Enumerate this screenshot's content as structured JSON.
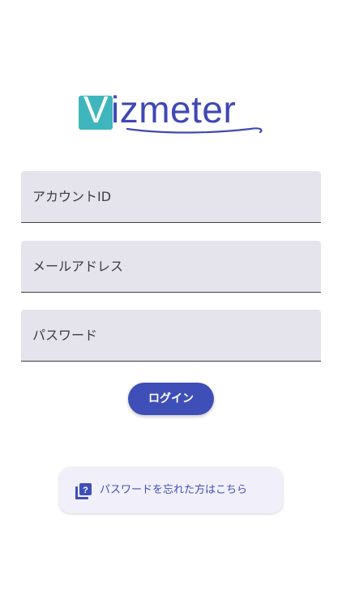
{
  "logo": {
    "initial": "V",
    "rest": "izmeter"
  },
  "form": {
    "account_id_placeholder": "アカウントID",
    "email_placeholder": "メールアドレス",
    "password_placeholder": "パスワード"
  },
  "login_button": {
    "label": "ログイン"
  },
  "forgot_password": {
    "label": "パスワードを忘れた方はこちら",
    "icon": "help-library-icon"
  },
  "colors": {
    "brand": "#3f48b5",
    "logo_teal": "#3fb6bd",
    "field_background": "#e5e3ec",
    "button": "#3f4fb8"
  }
}
